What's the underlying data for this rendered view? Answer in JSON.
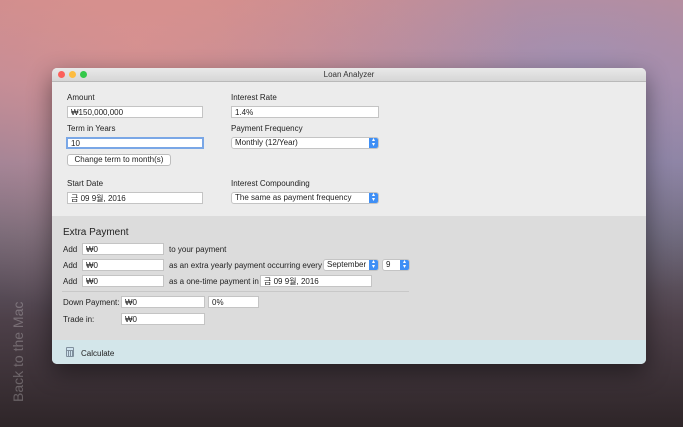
{
  "window": {
    "title": "Loan Analyzer"
  },
  "watermark": "Back to the Mac",
  "form": {
    "amount_label": "Amount",
    "amount_value": "₩150,000,000",
    "interest_rate_label": "Interest Rate",
    "interest_rate_value": "1.4%",
    "term_label": "Term in Years",
    "term_value": "10",
    "payment_frequency_label": "Payment Frequency",
    "payment_frequency_value": "Monthly (12/Year)",
    "change_term_button": "Change term to month(s)",
    "start_date_label": "Start Date",
    "start_date_value": "금 09 9월, 2016",
    "interest_compounding_label": "Interest Compounding",
    "interest_compounding_value": "The same as payment frequency"
  },
  "extra_payment": {
    "title": "Extra Payment",
    "add_label": "Add",
    "row1_value": "₩0",
    "row1_suffix": "to your payment",
    "row2_value": "₩0",
    "row2_suffix": "as an extra yearly payment occurring every",
    "row2_month": "September",
    "row2_day": "9",
    "row3_value": "₩0",
    "row3_suffix": "as a one-time payment in",
    "row3_date": "금 09 9월, 2016",
    "down_payment_label": "Down Payment:",
    "down_payment_value": "₩0",
    "down_payment_percent": "0%",
    "trade_in_label": "Trade in:",
    "trade_in_value": "₩0"
  },
  "footer": {
    "calculate_label": "Calculate"
  },
  "colors": {
    "accent": "#3f8ff5",
    "footer_bg": "#d3e6ea"
  }
}
